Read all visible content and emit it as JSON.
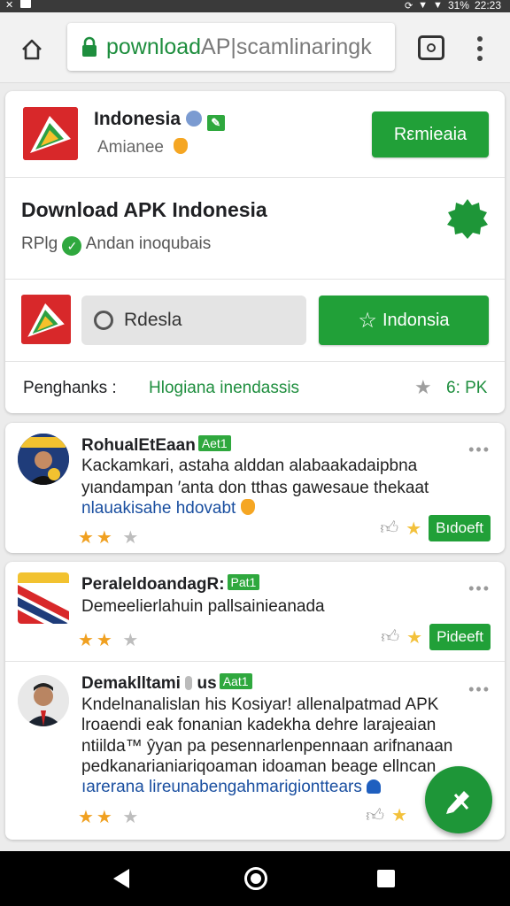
{
  "status_bar": {
    "left_icons": [
      "notification-icon",
      "image-icon"
    ],
    "battery": "31%",
    "time": "22:23"
  },
  "browser": {
    "url_primary": "pownload",
    "url_secondary": "AP|scamlinaringk"
  },
  "app_header": {
    "name": "Indonesia",
    "subtitle": "Amianee",
    "button": "Rεmieaia"
  },
  "download": {
    "title": "Download APK Indonesia",
    "meta_prefix": "RPlg",
    "meta_text": "Andan inoqubais"
  },
  "action_row": {
    "search_text": "Rdesla",
    "button": "Indonsia"
  },
  "info_row": {
    "label": "Penghanks :",
    "value": "Hlogiana inendassis",
    "rating": "6: PK"
  },
  "reviews": [
    {
      "name": "RohualEtEaan",
      "badge": "Aet1",
      "lines": [
        "Kackamkari,  astaha alddan  alabaakadaipbna",
        "yιandampan  ′anta  don  tthas  gawesaue  thekaat"
      ],
      "link": "nlauakisahe hdovabt",
      "button": "Bıdoeft"
    },
    {
      "name": "PeraleldoandagR:",
      "badge": "Pat1",
      "lines": [
        "Demeelierlahuin  pallsainieanada"
      ],
      "link": "",
      "button": "Pideeft"
    },
    {
      "name": "Demaklltami",
      "name_suffix": "us",
      "badge": "Aat1",
      "lines": [
        "Kndelnanalislan  his  Kosiyar!  allenalpatmad APK",
        "lroaendi  eak  fonanian  kadekha  dehre  larajeaian",
        "ntiilda™  ŷyan  pa  pesennarlenpennaan  arifnanaan",
        "pedkanarianiariqoaman  idoaman  beage  ellncan"
      ],
      "link": "ıarerana lireunabengahmarigionttears"
    }
  ],
  "colors": {
    "accent": "#21a038",
    "link": "#1a4fa0",
    "star": "#f0a020"
  }
}
